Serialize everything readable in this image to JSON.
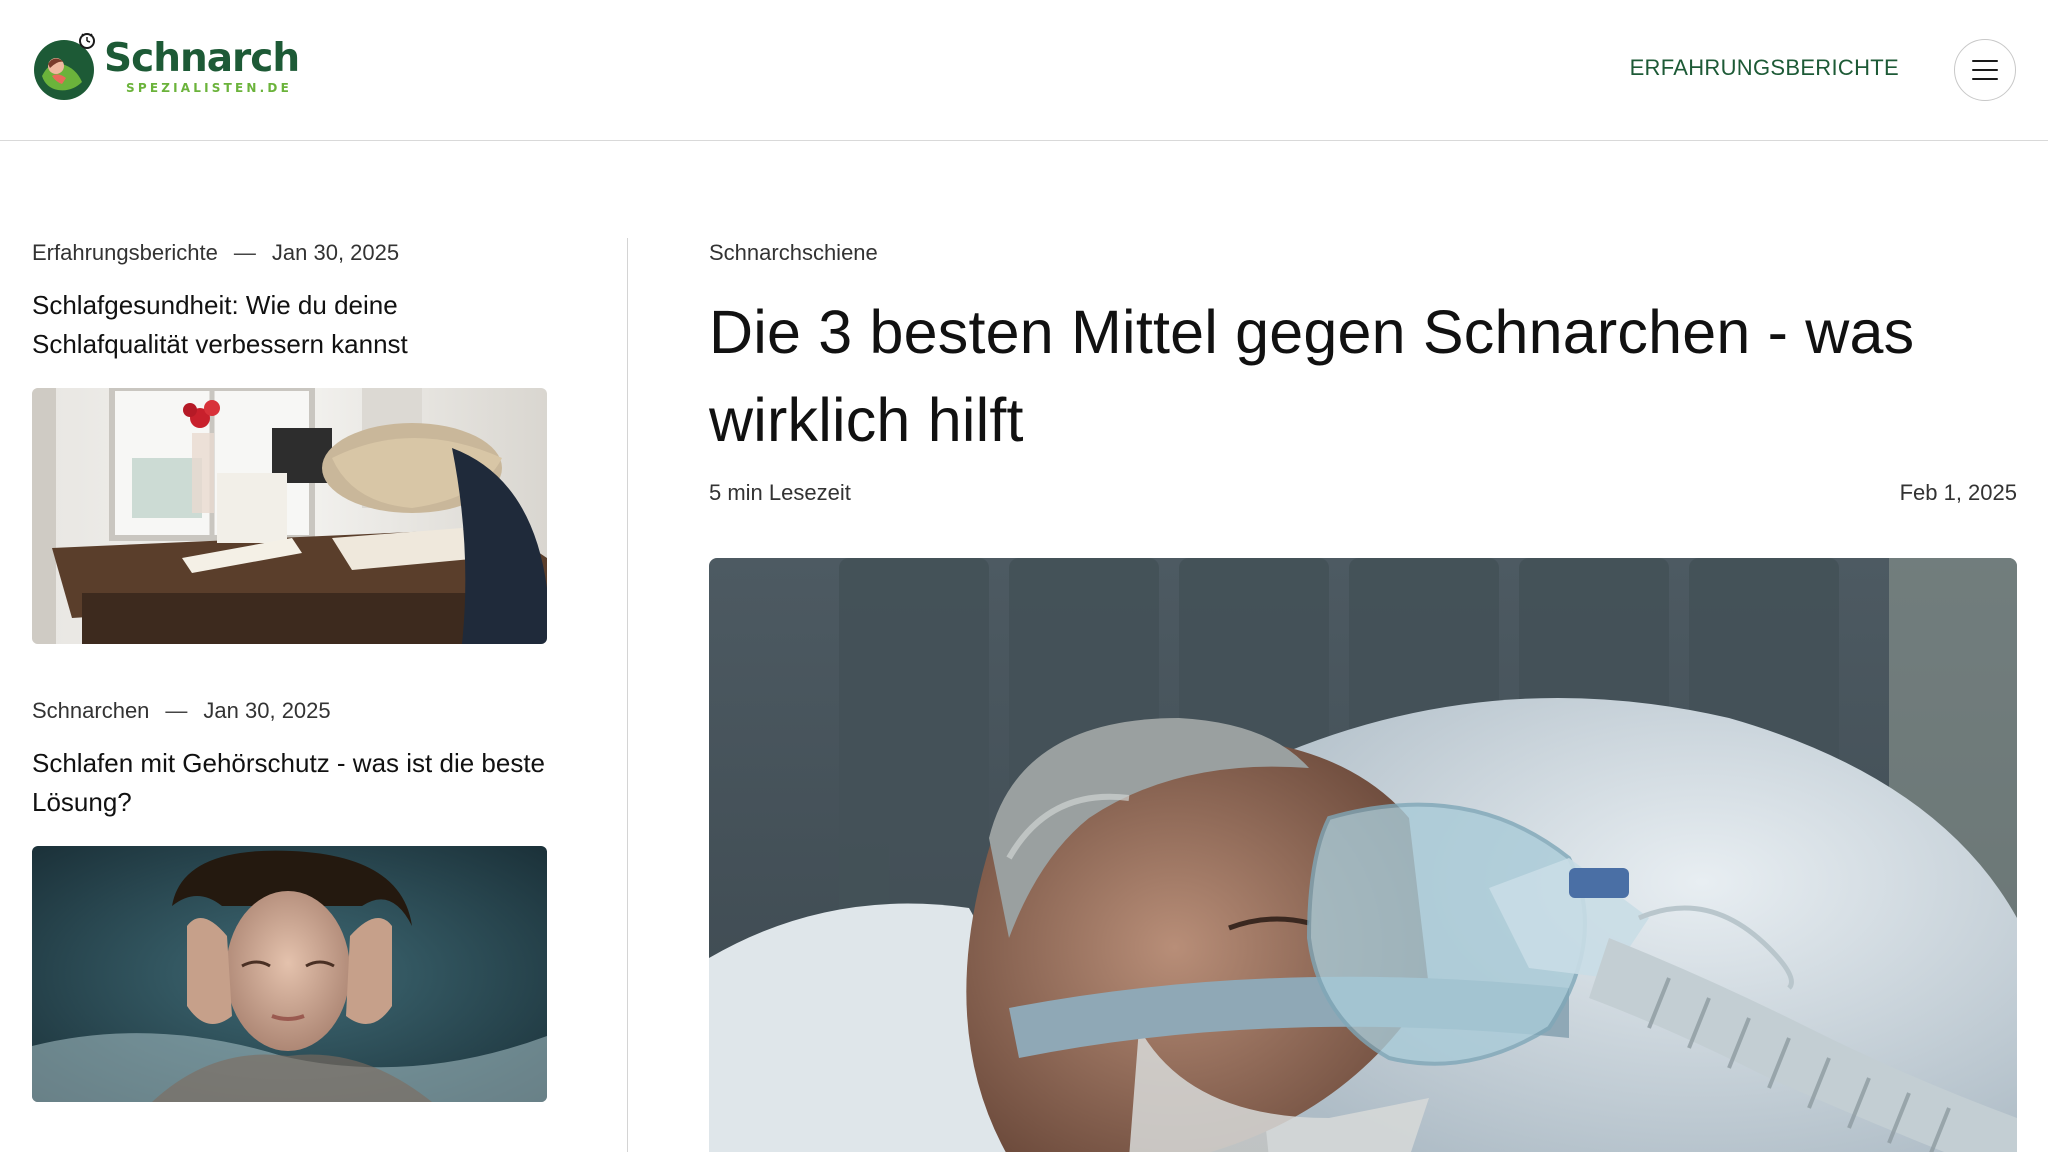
{
  "header": {
    "logo_title": "Schnarch",
    "logo_subtitle": "SPEZIALISTEN.DE",
    "nav_link": "ERFAHRUNGSBERICHTE"
  },
  "sidebar_posts": [
    {
      "category": "Erfahrungsberichte",
      "separator": "—",
      "date": "Jan 30, 2025",
      "title": "Schlafgesundheit: Wie du deine Schlafqualität verbessern kannst"
    },
    {
      "category": "Schnarchen",
      "separator": "—",
      "date": "Jan 30, 2025",
      "title": "Schlafen mit Gehörschutz - was ist die beste Lösung?"
    }
  ],
  "featured": {
    "category": "Schnarchschiene",
    "title": "Die 3 besten Mittel gegen Schnarchen - was wirklich hilft",
    "read_time": "5 min Lesezeit",
    "date": "Feb 1, 2025"
  },
  "colors": {
    "brand_green": "#1d5a36",
    "accent_green": "#6bb33b"
  },
  "icons": [
    "hamburger-menu-icon"
  ]
}
